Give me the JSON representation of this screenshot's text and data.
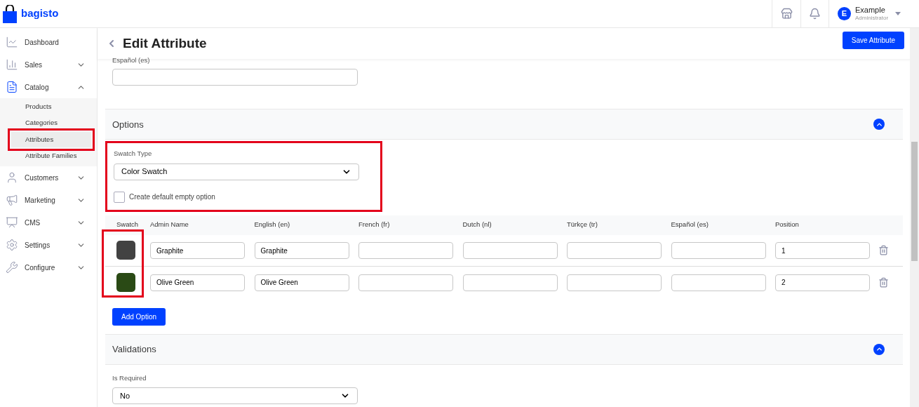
{
  "brand": "bagisto",
  "header": {
    "user": {
      "initial": "E",
      "name": "Example",
      "role": "Administrator"
    }
  },
  "sidebar": {
    "items": [
      {
        "label": "Dashboard"
      },
      {
        "label": "Sales",
        "expanded": false
      },
      {
        "label": "Catalog",
        "expanded": true,
        "children": [
          {
            "label": "Products",
            "selected": false
          },
          {
            "label": "Categories",
            "selected": false
          },
          {
            "label": "Attributes",
            "selected": true
          },
          {
            "label": "Attribute Families",
            "selected": false
          }
        ]
      },
      {
        "label": "Customers",
        "expanded": false
      },
      {
        "label": "Marketing",
        "expanded": false
      },
      {
        "label": "CMS",
        "expanded": false
      },
      {
        "label": "Settings",
        "expanded": false
      },
      {
        "label": "Configure",
        "expanded": false
      }
    ]
  },
  "page": {
    "title": "Edit Attribute",
    "save_button": "Save Attribute"
  },
  "spanish_field": {
    "label": "Español (es)"
  },
  "options": {
    "title": "Options",
    "expanded": true,
    "swatch_type": {
      "label": "Swatch Type",
      "value": "Color Swatch",
      "highlighted": true
    },
    "default_empty": {
      "label": "Create default empty option",
      "checked": false
    },
    "columns": [
      "Swatch",
      "Admin Name",
      "English (en)",
      "French (fr)",
      "Dutch (nl)",
      "Türkçe (tr)",
      "Español (es)",
      "Position"
    ],
    "swatch_highlighted": true,
    "rows": [
      {
        "cells": [
          {
            "kind": "swatch",
            "color": "#424242"
          },
          {
            "kind": "filled",
            "value": "Graphite"
          },
          {
            "kind": "filled",
            "value": "Graphite"
          },
          {
            "kind": "empty"
          },
          {
            "kind": "empty"
          },
          {
            "kind": "empty"
          },
          {
            "kind": "empty"
          },
          {
            "kind": "filled",
            "value": "1"
          }
        ]
      },
      {
        "cells": [
          {
            "kind": "swatch",
            "color": "#2a4a15"
          },
          {
            "kind": "filled",
            "value": "Olive Green"
          },
          {
            "kind": "filled",
            "value": "Olive Green"
          },
          {
            "kind": "empty"
          },
          {
            "kind": "empty"
          },
          {
            "kind": "empty"
          },
          {
            "kind": "empty"
          },
          {
            "kind": "filled",
            "value": "2"
          }
        ]
      }
    ],
    "add_button": "Add Option"
  },
  "validations": {
    "title": "Validations",
    "expanded": true,
    "is_required": {
      "label": "Is Required",
      "value": "No"
    }
  }
}
